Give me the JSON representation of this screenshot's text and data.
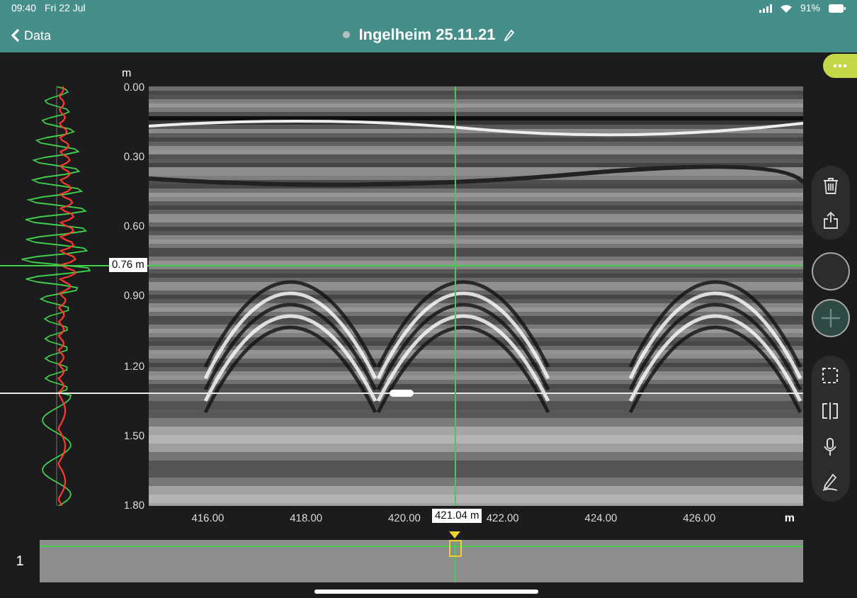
{
  "status_bar": {
    "time": "09:40",
    "date": "Fri 22 Jul",
    "battery": "91%"
  },
  "nav_bar": {
    "back": "Data",
    "title": "Ingelheim 25.11.21"
  },
  "depth_axis": {
    "unit": "m",
    "ticks": [
      "0.00",
      "0.30",
      "0.60",
      "0.90",
      "1.20",
      "1.50",
      "1.80"
    ]
  },
  "distance_axis": {
    "unit": "m",
    "ticks": [
      "416.00",
      "418.00",
      "420.00",
      "422.00",
      "424.00",
      "426.00"
    ]
  },
  "cursor": {
    "depth": "0.76 m",
    "position": "421.04 m"
  },
  "overview": {
    "channel": "1"
  }
}
